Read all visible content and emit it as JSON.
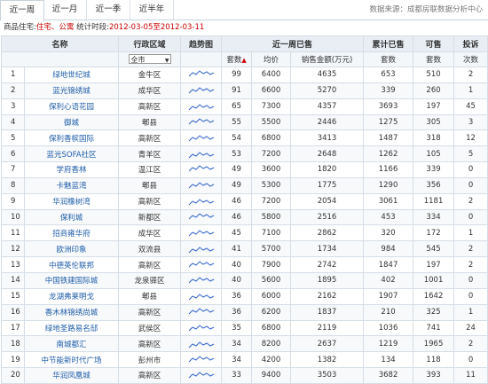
{
  "tabs": [
    "近一周",
    "近一月",
    "近一季",
    "近半年"
  ],
  "active_tab": 0,
  "source": "数据来源：成都房联数据分析中心",
  "filter": {
    "label": "商品住宅:",
    "type": "住宅、公寓",
    "period_label": "统计时段:",
    "period": "2012-03-05至2012-03-11"
  },
  "headers": {
    "name": "名称",
    "district": "行政区域",
    "trend": "趋势图",
    "week_sales": "近一周已售",
    "cum_sales": "累计已售",
    "available": "可售",
    "complaints": "投诉",
    "units": "套数",
    "avg_price": "均价",
    "amount": "销售金额(万元)",
    "cum_units": "套数",
    "avail_units": "套数",
    "complaint_count": "次数",
    "district_select": "全市"
  },
  "rows": [
    {
      "no": "1",
      "name": "绿地世纪城",
      "district": "金牛区",
      "units": "99",
      "price": "6400",
      "amount": "4635",
      "cum": "653",
      "avail": "510",
      "comp": "2"
    },
    {
      "no": "2",
      "name": "蓝光锦绣城",
      "district": "成华区",
      "units": "91",
      "price": "6600",
      "amount": "5270",
      "cum": "339",
      "avail": "260",
      "comp": "1"
    },
    {
      "no": "3",
      "name": "保利心语花园",
      "district": "高新区",
      "units": "65",
      "price": "7300",
      "amount": "4357",
      "cum": "3693",
      "avail": "197",
      "comp": "45"
    },
    {
      "no": "4",
      "name": "御城",
      "district": "郫县",
      "units": "55",
      "price": "5500",
      "amount": "2446",
      "cum": "1275",
      "avail": "305",
      "comp": "3"
    },
    {
      "no": "5",
      "name": "保利香槟国际",
      "district": "高新区",
      "units": "54",
      "price": "6800",
      "amount": "3413",
      "cum": "1487",
      "avail": "318",
      "comp": "12"
    },
    {
      "no": "6",
      "name": "蓝光SOFA社区",
      "district": "青羊区",
      "units": "53",
      "price": "7200",
      "amount": "2648",
      "cum": "1262",
      "avail": "105",
      "comp": "5"
    },
    {
      "no": "7",
      "name": "学府香林",
      "district": "温江区",
      "units": "49",
      "price": "3600",
      "amount": "1820",
      "cum": "1166",
      "avail": "339",
      "comp": "0"
    },
    {
      "no": "8",
      "name": "卡魅蓝湾",
      "district": "郫县",
      "units": "49",
      "price": "5300",
      "amount": "1775",
      "cum": "1290",
      "avail": "356",
      "comp": "0"
    },
    {
      "no": "9",
      "name": "华润橡树湾",
      "district": "高新区",
      "units": "46",
      "price": "7200",
      "amount": "2054",
      "cum": "3061",
      "avail": "1181",
      "comp": "2"
    },
    {
      "no": "10",
      "name": "保利城",
      "district": "新都区",
      "units": "46",
      "price": "5800",
      "amount": "2516",
      "cum": "453",
      "avail": "334",
      "comp": "0"
    },
    {
      "no": "11",
      "name": "招商雍华府",
      "district": "成华区",
      "units": "45",
      "price": "7100",
      "amount": "2862",
      "cum": "320",
      "avail": "172",
      "comp": "1"
    },
    {
      "no": "12",
      "name": "欧洲印象",
      "district": "双流县",
      "units": "41",
      "price": "5700",
      "amount": "1734",
      "cum": "984",
      "avail": "545",
      "comp": "2"
    },
    {
      "no": "13",
      "name": "中德英伦联邦",
      "district": "高新区",
      "units": "40",
      "price": "7900",
      "amount": "2742",
      "cum": "1847",
      "avail": "197",
      "comp": "2"
    },
    {
      "no": "14",
      "name": "中国铁建国际城",
      "district": "龙泉驿区",
      "units": "40",
      "price": "5600",
      "amount": "1895",
      "cum": "402",
      "avail": "1001",
      "comp": "0"
    },
    {
      "no": "15",
      "name": "龙湖弗莱明戈",
      "district": "郫县",
      "units": "36",
      "price": "6000",
      "amount": "2162",
      "cum": "1907",
      "avail": "1642",
      "comp": "0"
    },
    {
      "no": "16",
      "name": "香木林锦绣尚城",
      "district": "高新区",
      "units": "36",
      "price": "6200",
      "amount": "1837",
      "cum": "210",
      "avail": "325",
      "comp": "1"
    },
    {
      "no": "17",
      "name": "绿地圣路易名邸",
      "district": "武侯区",
      "units": "35",
      "price": "6800",
      "amount": "2119",
      "cum": "1036",
      "avail": "741",
      "comp": "24"
    },
    {
      "no": "18",
      "name": "南城都汇",
      "district": "高新区",
      "units": "34",
      "price": "8200",
      "amount": "2637",
      "cum": "1219",
      "avail": "1965",
      "comp": "2"
    },
    {
      "no": "19",
      "name": "中节能新时代广场",
      "district": "彭州市",
      "units": "34",
      "price": "4200",
      "amount": "1382",
      "cum": "134",
      "avail": "118",
      "comp": "0"
    },
    {
      "no": "20",
      "name": "华润凤凰城",
      "district": "高新区",
      "units": "33",
      "price": "9400",
      "amount": "3503",
      "cum": "3682",
      "avail": "393",
      "comp": "11"
    }
  ],
  "colors": {
    "name_link": "#1f5da8",
    "accent_red": "#cc0000",
    "sparkline": "#3366cc"
  },
  "icons": {
    "sort": "arrow-up-icon",
    "dropdown": "chevron-down-icon",
    "trend": "sparkline-icon"
  }
}
